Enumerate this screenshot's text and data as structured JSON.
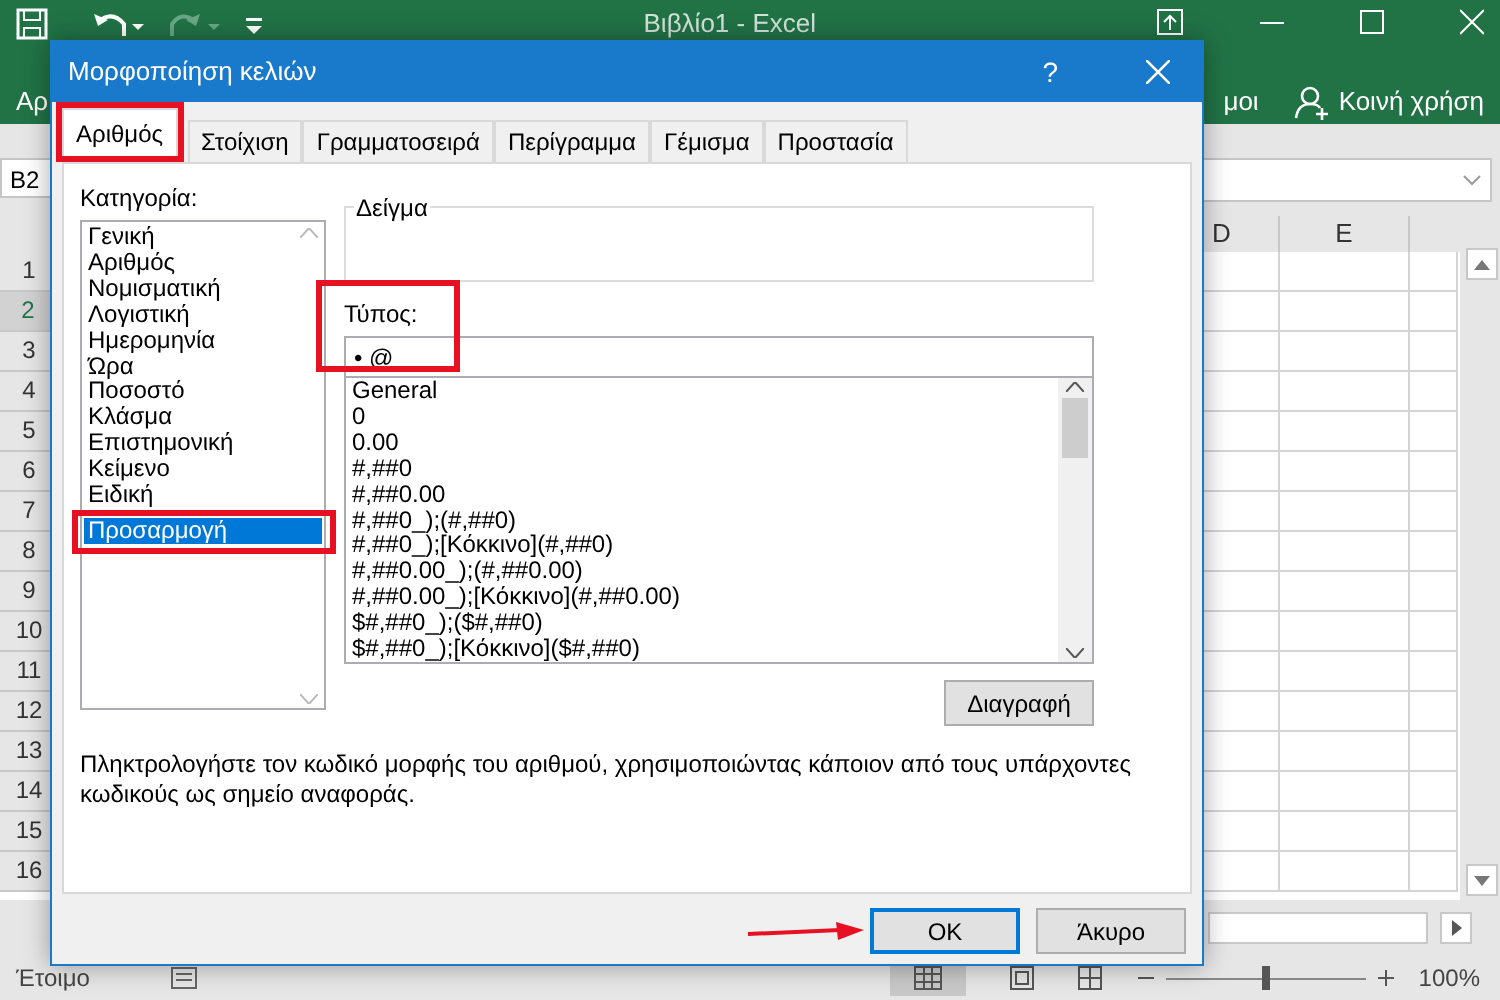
{
  "app": {
    "title": "Βιβλίο1  -  Excel",
    "ribbon_left": "Αρ",
    "ribbon_right": "μοι",
    "share": "Κοινή χρήση",
    "name_box": "B2",
    "columns": [
      "D",
      "E"
    ],
    "rows": [
      {
        "label": "1",
        "selected": false
      },
      {
        "label": "2",
        "selected": true
      },
      {
        "label": "3",
        "selected": false
      },
      {
        "label": "4",
        "selected": false
      },
      {
        "label": "5",
        "selected": false
      },
      {
        "label": "6",
        "selected": false
      },
      {
        "label": "7",
        "selected": false
      },
      {
        "label": "8",
        "selected": false
      },
      {
        "label": "9",
        "selected": false
      },
      {
        "label": "10",
        "selected": false
      },
      {
        "label": "11",
        "selected": false
      },
      {
        "label": "12",
        "selected": false
      },
      {
        "label": "13",
        "selected": false
      },
      {
        "label": "14",
        "selected": false
      },
      {
        "label": "15",
        "selected": false
      },
      {
        "label": "16",
        "selected": false
      }
    ],
    "status": "Έτοιμο",
    "zoom": "100%",
    "zoom_slider": {
      "level": 0.5
    }
  },
  "dialog": {
    "title": "Μορφοποίηση κελιών",
    "help": "?",
    "tabs": [
      {
        "label": "Αριθμός",
        "selected": true,
        "highlighted": true
      },
      {
        "label": "Στοίχιση",
        "selected": false,
        "highlighted": false
      },
      {
        "label": "Γραμματοσειρά",
        "selected": false,
        "highlighted": false
      },
      {
        "label": "Περίγραμμα",
        "selected": false,
        "highlighted": false
      },
      {
        "label": "Γέμισμα",
        "selected": false,
        "highlighted": false
      },
      {
        "label": "Προστασία",
        "selected": false,
        "highlighted": false
      }
    ],
    "category_label": "Κατηγορία:",
    "categories": [
      {
        "label": "Γενική",
        "selected": false,
        "highlighted": false
      },
      {
        "label": "Αριθμός",
        "selected": false,
        "highlighted": false
      },
      {
        "label": "Νομισματική",
        "selected": false,
        "highlighted": false
      },
      {
        "label": "Λογιστική",
        "selected": false,
        "highlighted": false
      },
      {
        "label": "Ημερομηνία",
        "selected": false,
        "highlighted": false
      },
      {
        "label": "Ώρα",
        "selected": false,
        "highlighted": false
      },
      {
        "label": "Ποσοστό",
        "selected": false,
        "highlighted": false
      },
      {
        "label": "Κλάσμα",
        "selected": false,
        "highlighted": false
      },
      {
        "label": "Επιστημονική",
        "selected": false,
        "highlighted": false
      },
      {
        "label": "Κείμενο",
        "selected": false,
        "highlighted": false
      },
      {
        "label": "Ειδική",
        "selected": false,
        "highlighted": false
      },
      {
        "label": "Προσαρμογή",
        "selected": true,
        "highlighted": true
      }
    ],
    "sample_label": "Δείγμα",
    "type_label": "Τύπος:",
    "type_value": "• @",
    "type_highlighted": true,
    "formats": [
      "General",
      "0",
      "0.00",
      "#,##0",
      "#,##0.00",
      "#,##0_);(#,##0)",
      "#,##0_);[Κόκκινο](#,##0)",
      "#,##0.00_);(#,##0.00)",
      "#,##0.00_);[Κόκκινο](#,##0.00)",
      "$#,##0_);($#,##0)",
      "$#,##0_);[Κόκκινο]($#,##0)"
    ],
    "delete_button": "Διαγραφή",
    "description": "Πληκτρολογήστε τον κωδικό μορφής του αριθμού, χρησιμοποιώντας κάποιον από τους υπάρχοντες κωδικούς ως σημείο αναφοράς.",
    "buttons": [
      {
        "label": "OK",
        "default": true,
        "pointed": true
      },
      {
        "label": "Άκυρο",
        "default": false,
        "pointed": false
      }
    ]
  }
}
